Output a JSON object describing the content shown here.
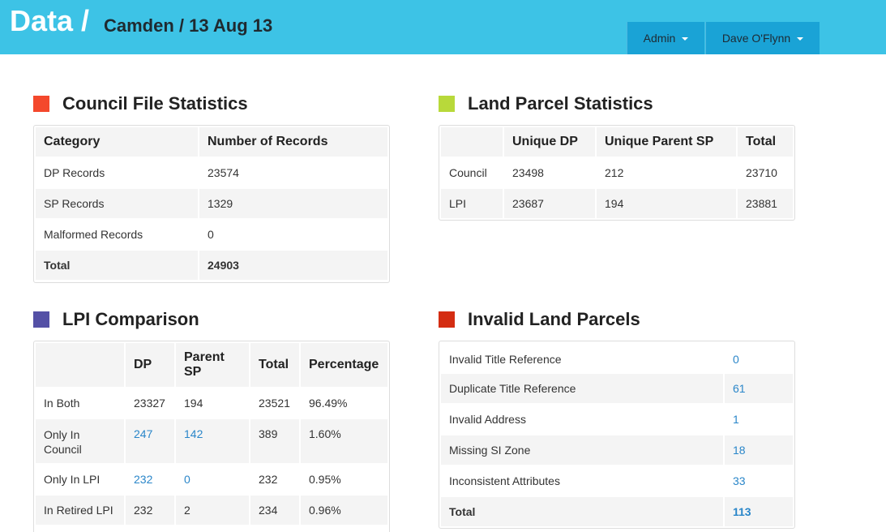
{
  "header": {
    "brand": "Data /",
    "subtitle": "Camden / 13 Aug 13",
    "admin_label": "Admin",
    "user_label": "Dave O'Flynn"
  },
  "colors": {
    "header_bg": "#3dc3e6",
    "nav_bg": "#1aa3d6",
    "council_square": "#f4482c",
    "land_parcel_square": "#b8d93a",
    "lpi_square": "#5450a6",
    "invalid_square": "#d42d12",
    "link": "#2a86c9"
  },
  "council": {
    "title": "Council File Statistics",
    "headers": [
      "Category",
      "Number of Records"
    ],
    "rows": [
      [
        "DP Records",
        "23574"
      ],
      [
        "SP Records",
        "1329"
      ],
      [
        "Malformed Records",
        "0"
      ]
    ],
    "total": [
      "Total",
      "24903"
    ]
  },
  "landparcel": {
    "title": "Land Parcel Statistics",
    "headers": [
      "",
      "Unique DP",
      "Unique Parent SP",
      "Total"
    ],
    "rows": [
      [
        "Council",
        "23498",
        "212",
        "23710"
      ],
      [
        "LPI",
        "23687",
        "194",
        "23881"
      ]
    ]
  },
  "lpi": {
    "title": "LPI Comparison",
    "headers": [
      "",
      "DP",
      "Parent SP",
      "Total",
      "Percentage"
    ],
    "rows": [
      [
        "In Both",
        "23327",
        "194",
        "23521",
        "96.49%"
      ],
      [
        "Only In Council",
        "247",
        "142",
        "389",
        "1.60%"
      ],
      [
        "Only In LPI",
        "232",
        "0",
        "232",
        "0.95%"
      ],
      [
        "In Retired LPI",
        "232",
        "2",
        "234",
        "0.96%"
      ]
    ]
  },
  "invalid": {
    "title": "Invalid Land Parcels",
    "rows": [
      [
        "Invalid Title Reference",
        "0"
      ],
      [
        "Duplicate Title Reference",
        "61"
      ],
      [
        "Invalid Address",
        "1"
      ],
      [
        "Missing SI Zone",
        "18"
      ],
      [
        "Inconsistent Attributes",
        "33"
      ]
    ],
    "total": [
      "Total",
      "113"
    ]
  }
}
